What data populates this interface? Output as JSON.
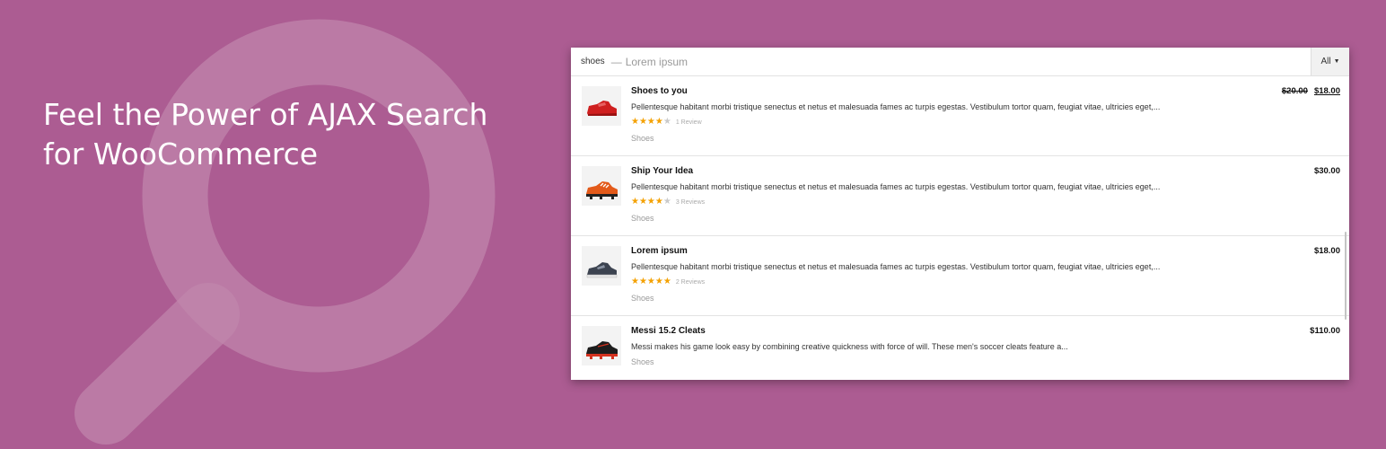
{
  "hero": {
    "line1": "Feel the Power of AJAX Search",
    "line2": "for WooCommerce"
  },
  "colors": {
    "background": "#ac5c92",
    "magnifier_overlay": "#c186ac",
    "star_active": "#f4a100",
    "star_inactive": "#c9c9c9"
  },
  "search": {
    "query": "shoes",
    "dash": "—",
    "hint": "Lorem ipsum",
    "category": "All",
    "caret_icon": "caret-down-icon"
  },
  "results": [
    {
      "title": "Shoes to you",
      "description": "Pellentesque habitant morbi tristique senectus et netus et malesuada fames ac turpis egestas. Vestibulum tortor quam, feugiat vitae, ultricies eget,...",
      "rating": 4,
      "reviews": "1 Review",
      "category": "Shoes",
      "price_old": "$20.00",
      "price": "$18.00",
      "thumb_icon": "red-shoe-icon"
    },
    {
      "title": "Ship Your Idea",
      "description": "Pellentesque habitant morbi tristique senectus et netus et malesuada fames ac turpis egestas. Vestibulum tortor quam, feugiat vitae, ultricies eget,...",
      "rating": 4,
      "reviews": "3 Reviews",
      "category": "Shoes",
      "price_old": "",
      "price": "$30.00",
      "thumb_icon": "orange-cleat-icon"
    },
    {
      "title": "Lorem ipsum",
      "description": "Pellentesque habitant morbi tristique senectus et netus et malesuada fames ac turpis egestas. Vestibulum tortor quam, feugiat vitae, ultricies eget,...",
      "rating": 5,
      "reviews": "2 Reviews",
      "category": "Shoes",
      "price_old": "",
      "price": "$18.00",
      "thumb_icon": "grey-sneaker-icon"
    },
    {
      "title": "Messi 15.2 Cleats",
      "description": "Messi makes his game look easy by combining creative quickness with force of will. These men's soccer cleats feature a...",
      "rating": null,
      "reviews": "",
      "category": "Shoes",
      "price_old": "",
      "price": "$110.00",
      "thumb_icon": "black-cleat-icon"
    }
  ]
}
